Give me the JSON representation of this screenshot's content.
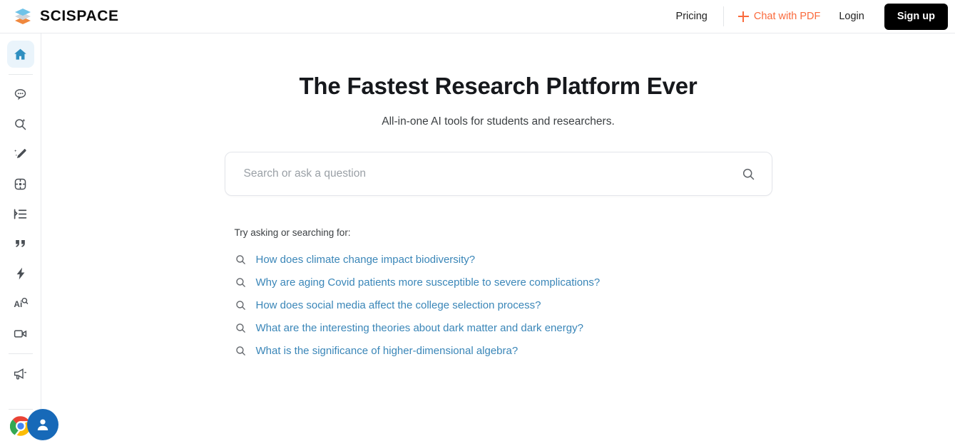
{
  "header": {
    "brand_name": "SCISPACE",
    "brand_logo_icon": "layers-logo-icon",
    "pricing_label": "Pricing",
    "chat_pdf_label": "Chat with PDF",
    "chat_pdf_icon": "plus-icon",
    "login_label": "Login",
    "signup_label": "Sign up",
    "accent_color": "#fa6a3c",
    "signup_bg": "#000000"
  },
  "sidebar": {
    "items": [
      {
        "name": "home",
        "icon": "home-icon",
        "active": true
      },
      {
        "name": "chat",
        "icon": "chat-bubble-icon",
        "active": false
      },
      {
        "name": "ai-search",
        "icon": "search-sparkle-icon",
        "active": false
      },
      {
        "name": "ai-writer",
        "icon": "pencil-sparkle-icon",
        "active": false
      },
      {
        "name": "science",
        "icon": "atom-icon",
        "active": false
      },
      {
        "name": "paraphrase",
        "icon": "indent-list-icon",
        "active": false
      },
      {
        "name": "citation",
        "icon": "quote-icon",
        "active": false
      },
      {
        "name": "quick-actions",
        "icon": "lightning-bolt-icon",
        "active": false
      },
      {
        "name": "ai-detector",
        "icon": "ai-detector-icon",
        "active": false
      },
      {
        "name": "video",
        "icon": "video-camera-icon",
        "active": false
      },
      {
        "name": "announcements",
        "icon": "megaphone-icon",
        "active": false
      }
    ],
    "chrome_icon": "chrome-browser-icon",
    "avatar_icon": "user-avatar-icon",
    "active_color": "#2f8fc0",
    "active_bg": "#eaf4fb",
    "avatar_bg": "#1769b8"
  },
  "main": {
    "headline": "The Fastest Research Platform Ever",
    "subhead": "All-in-one AI tools for students and researchers.",
    "search": {
      "value": "",
      "placeholder": "Search or ask a question",
      "icon": "search-icon"
    },
    "suggestions": {
      "label": "Try asking or searching for:",
      "icon": "search-icon",
      "items": [
        "How does climate change impact biodiversity?",
        "Why are aging Covid patients more susceptible to severe complications?",
        "How does social media affect the college selection process?",
        "What are the interesting theories about dark matter and dark energy?",
        "What is the significance of higher-dimensional algebra?"
      ],
      "link_color": "#3a86b8"
    }
  }
}
